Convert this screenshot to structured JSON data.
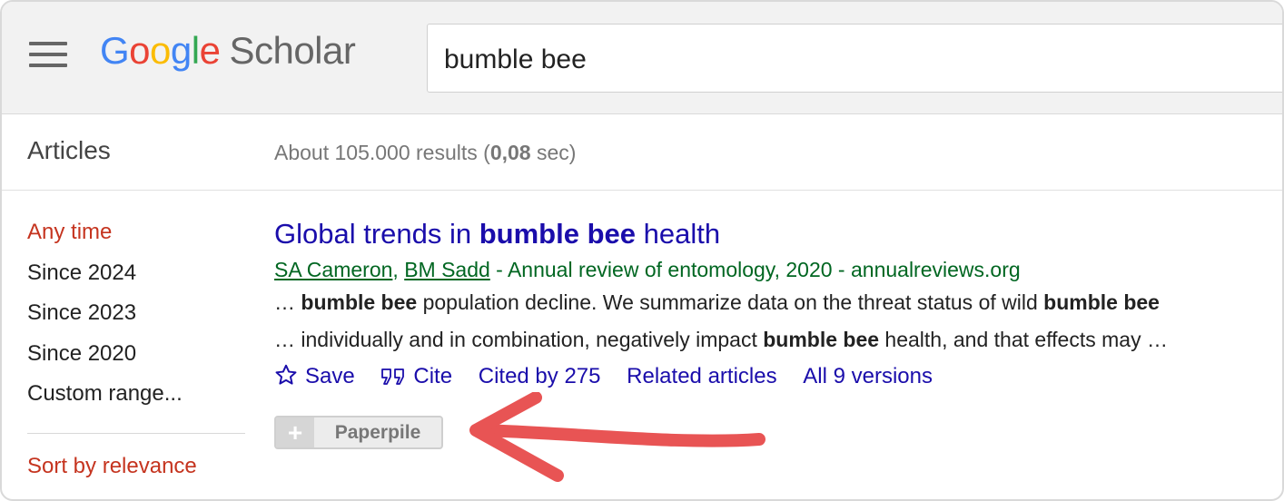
{
  "header": {
    "logo": {
      "google_letters": [
        "G",
        "o",
        "o",
        "g",
        "l",
        "e"
      ],
      "scholar": "Scholar"
    },
    "search": {
      "value": "bumble bee"
    }
  },
  "subheader": {
    "section_title": "Articles",
    "results_prefix": "About 105.000 results (",
    "results_time": "0,08",
    "results_suffix": " sec)"
  },
  "sidebar": {
    "time_filters": [
      {
        "label": "Any time",
        "active": true
      },
      {
        "label": "Since 2024",
        "active": false
      },
      {
        "label": "Since 2023",
        "active": false
      },
      {
        "label": "Since 2020",
        "active": false
      },
      {
        "label": "Custom range...",
        "active": false
      }
    ],
    "sort": "Sort by relevance"
  },
  "result": {
    "title_prefix": "Global trends in ",
    "title_bold": "bumble bee",
    "title_suffix": " health",
    "authors": [
      "SA Cameron",
      "BM Sadd"
    ],
    "author_sep": ", ",
    "meta_rest": " - Annual review of entomology, 2020 - annualreviews.org",
    "snippet1": {
      "a": "… ",
      "b1": "bumble bee",
      "c": " population decline. We summarize data on the threat status of wild ",
      "b2": "bumble bee"
    },
    "snippet2": {
      "a": "… individually and in combination, negatively impact ",
      "b1": "bumble bee",
      "c": " health, and that effects may …"
    },
    "actions": {
      "save": "Save",
      "cite": "Cite",
      "cited_by": "Cited by 275",
      "related": "Related articles",
      "versions": "All 9 versions"
    }
  },
  "paperpile": {
    "plus": "+",
    "label": "Paperpile"
  },
  "colors": {
    "link": "#1a0dab",
    "green": "#006621",
    "accent_red": "#c5341f",
    "arrow": "#e85454"
  },
  "icons": [
    "menu-icon",
    "star-icon",
    "quote-icon",
    "arrow-annotation"
  ]
}
